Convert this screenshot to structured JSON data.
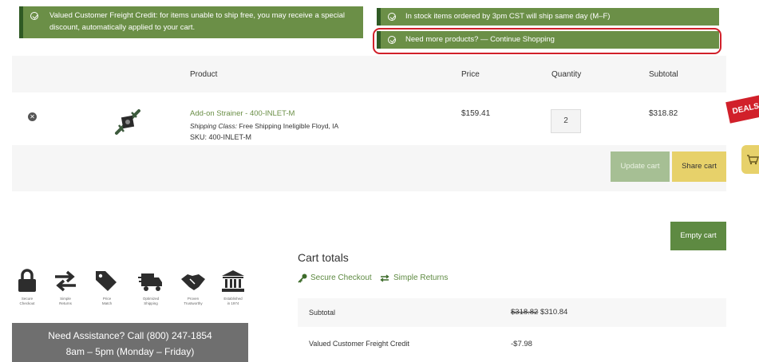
{
  "notices": {
    "freight_line1": "Valued Customer Freight Credit: for items unable to ship free, you may receive a special",
    "freight_line2": "discount, automatically applied to your cart.",
    "stock": "In stock items ordered by 3pm CST will ship same day (M–F)",
    "continue": "Need more products? — Continue Shopping"
  },
  "cart": {
    "headers": {
      "product": "Product",
      "price": "Price",
      "quantity": "Quantity",
      "subtotal": "Subtotal"
    },
    "item": {
      "name": "Add-on Strainer - 400-INLET-M",
      "shipping_label": "Shipping Class:",
      "shipping_value": "Free Shipping Ineligible Floyd, IA",
      "sku": "SKU: 400-INLET-M",
      "price": "$159.41",
      "quantity": "2",
      "subtotal": "$318.82"
    },
    "update_label": "Update cart",
    "share_label": "Share cart",
    "empty_label": "Empty cart"
  },
  "side": {
    "deals": "DEALS"
  },
  "badges": [
    {
      "icon": "lock-icon",
      "label1": "Secure",
      "label2": "Checkout"
    },
    {
      "icon": "swap-arrows-icon",
      "label1": "Simple",
      "label2": "Returns"
    },
    {
      "icon": "price-tag-icon",
      "label1": "Price",
      "label2": "Match"
    },
    {
      "icon": "truck-icon",
      "label1": "Optimized",
      "label2": "Shipping"
    },
    {
      "icon": "handshake-icon",
      "label1": "Proven",
      "label2": "Trustworthy"
    },
    {
      "icon": "bank-icon",
      "label1": "Established",
      "label2": "in 1974"
    }
  ],
  "assistance": {
    "line1": "Need Assistance? Call (800) 247-1854",
    "line2": "8am – 5pm (Monday – Friday)"
  },
  "totals": {
    "title": "Cart totals",
    "secure": "Secure Checkout",
    "returns": "Simple Returns",
    "subtotal_label": "Subtotal",
    "subtotal_old": "$318.82",
    "subtotal_new": "$310.84",
    "credit_label": "Valued Customer Freight Credit",
    "credit_value": "-$7.98"
  },
  "colors": {
    "notice_green": "#6b8f47",
    "link_green": "#6b8f47",
    "highlight_red": "#d1202a",
    "share_yellow": "#e7d16a",
    "empty_green": "#5e8a42"
  }
}
